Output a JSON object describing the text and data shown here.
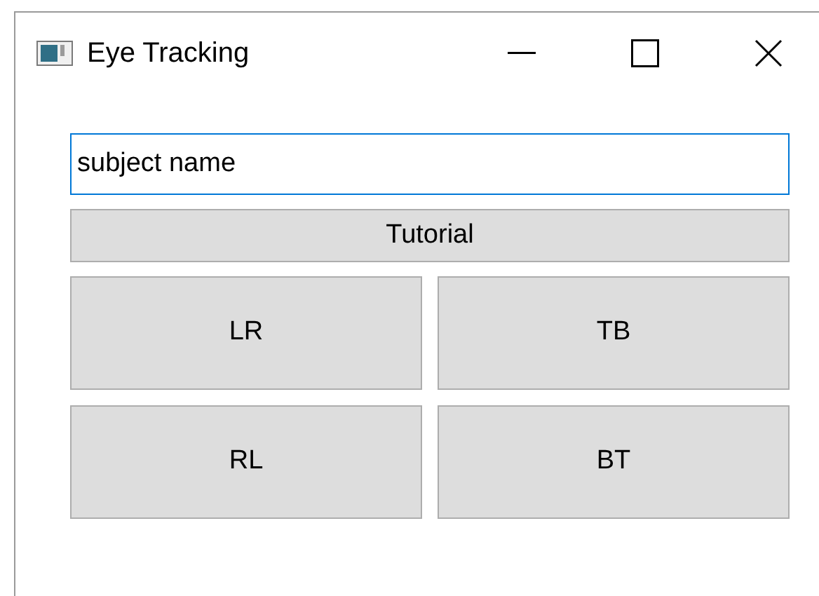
{
  "window": {
    "title": "Eye Tracking"
  },
  "name_field": {
    "value": "subject name",
    "focused": true
  },
  "tutorial_button": {
    "label": "Tutorial"
  },
  "buttons": [
    {
      "label": "LR"
    },
    {
      "label": "TB"
    },
    {
      "label": "RL"
    },
    {
      "label": "BT"
    }
  ]
}
